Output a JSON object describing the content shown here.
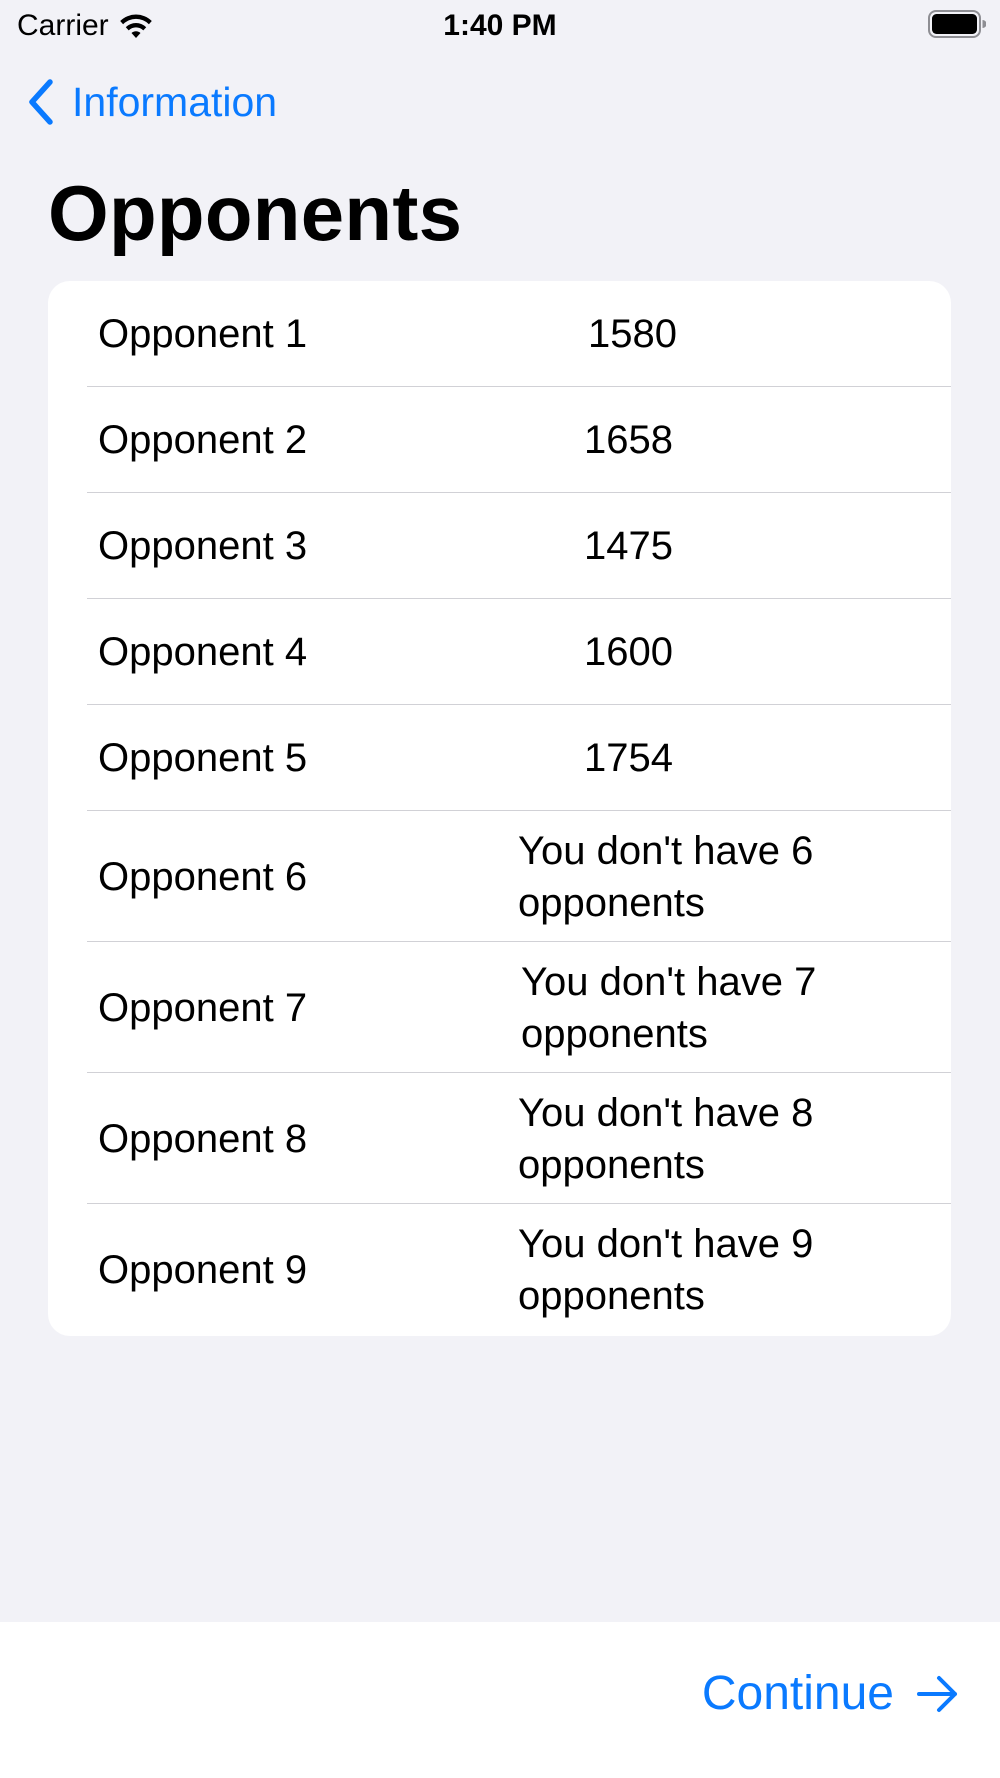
{
  "status_bar": {
    "carrier": "Carrier",
    "time": "1:40 PM"
  },
  "nav": {
    "back_label": "Information"
  },
  "page": {
    "title": "Opponents"
  },
  "opponents": [
    {
      "label": "Opponent 1",
      "value": "1580"
    },
    {
      "label": "Opponent 2",
      "value": "1658"
    },
    {
      "label": "Opponent 3",
      "value": "1475"
    },
    {
      "label": "Opponent 4",
      "value": "1600"
    },
    {
      "label": "Opponent 5",
      "value": "1754"
    },
    {
      "label": "Opponent 6",
      "value": "You don't have 6 opponents"
    },
    {
      "label": "Opponent 7",
      "value": "You don't have 7 opponents"
    },
    {
      "label": "Opponent 8",
      "value": "You don't have 8 opponents"
    },
    {
      "label": "Opponent 9",
      "value": "You don't have 9 opponents"
    }
  ],
  "footer": {
    "continue_label": "Continue"
  },
  "colors": {
    "accent": "#0a7aff",
    "background": "#f2f2f7",
    "card": "#ffffff",
    "separator": "#d1d1d6"
  },
  "icons": {
    "back": "chevron-left-icon",
    "forward": "arrow-right-icon",
    "wifi": "wifi-icon",
    "battery": "battery-icon"
  }
}
